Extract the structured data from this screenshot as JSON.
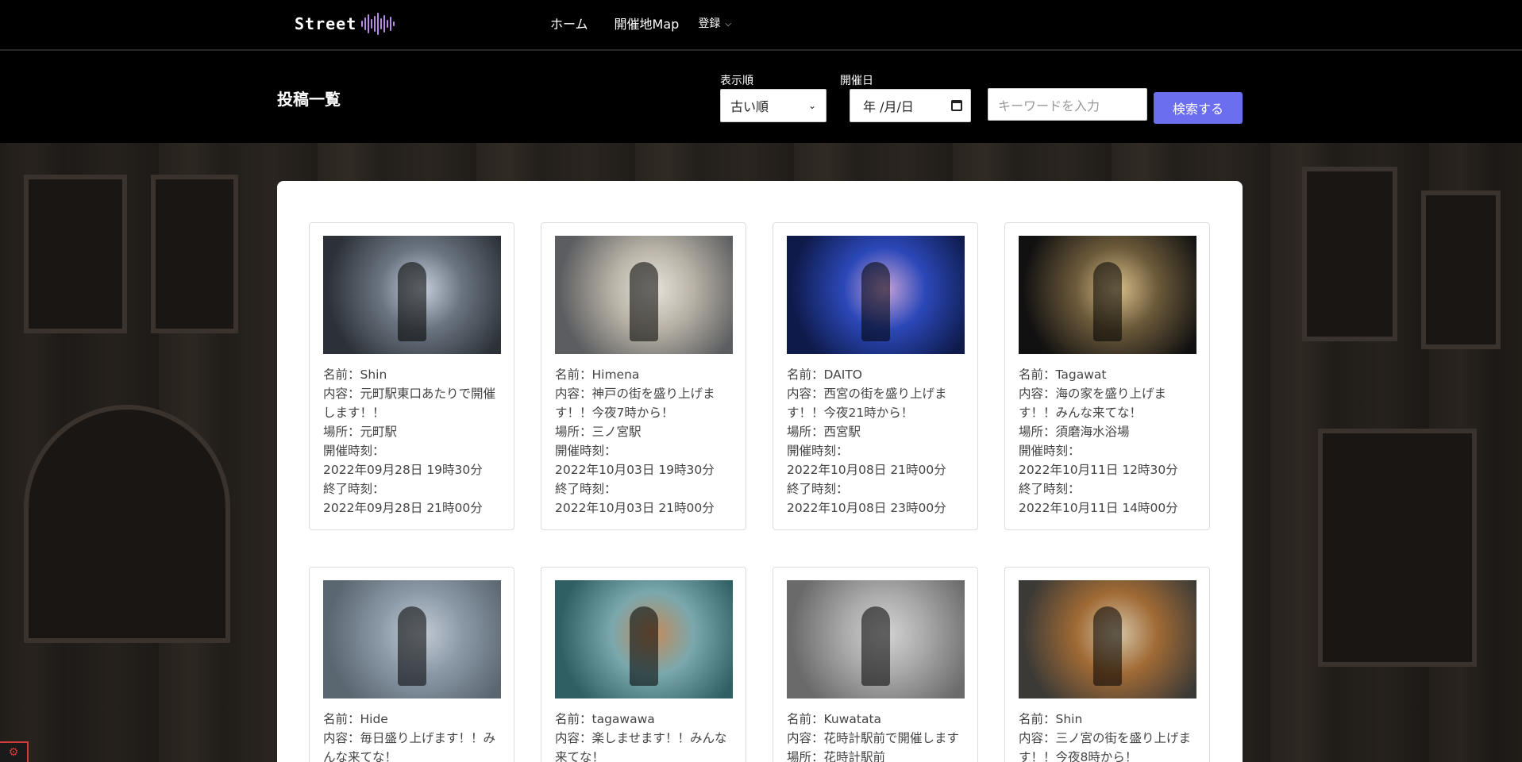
{
  "nav": {
    "brand": "Street",
    "links": [
      "ホーム",
      "開催地Map"
    ],
    "dropdown": "登録"
  },
  "search": {
    "title": "投稿一覧",
    "order_label": "表示順",
    "order_value": "古い順",
    "date_label": "開催日",
    "date_value": "年 /月/日",
    "keyword_placeholder": "キーワードを入力",
    "submit": "検索する"
  },
  "posts": [
    {
      "name": "名前：Shin",
      "content": "内容：元町駅東口あたりで開催します！！",
      "place": "場所：元町駅",
      "start_label": "開催時刻：",
      "start": "2022年09月28日 19時30分",
      "end_label": "終了時刻：",
      "end": "2022年09月28日 21時00分"
    },
    {
      "name": "名前：Himena",
      "content": "内容：神戸の街を盛り上げます！！今夜7時から！",
      "place": "場所：三ノ宮駅",
      "start_label": "開催時刻：",
      "start": "2022年10月03日 19時30分",
      "end_label": "終了時刻：",
      "end": "2022年10月03日 21時00分"
    },
    {
      "name": "名前：DAITO",
      "content": "内容：西宮の街を盛り上げます！！今夜21時から！",
      "place": "場所：西宮駅",
      "start_label": "開催時刻：",
      "start": "2022年10月08日 21時00分",
      "end_label": "終了時刻：",
      "end": "2022年10月08日 23時00分"
    },
    {
      "name": "名前：Tagawat",
      "content": "内容：海の家を盛り上げます！！みんな来てな！",
      "place": "場所：須磨海水浴場",
      "start_label": "開催時刻：",
      "start": "2022年10月11日 12時30分",
      "end_label": "終了時刻：",
      "end": "2022年10月11日 14時00分"
    },
    {
      "name": "名前：Hide",
      "content": "内容：毎日盛り上げます！！みんな来てな！",
      "place": "",
      "start_label": "",
      "start": "",
      "end_label": "",
      "end": ""
    },
    {
      "name": "名前：tagawawa",
      "content": "内容：楽しませます！！みんな来てな！",
      "place": "",
      "start_label": "",
      "start": "",
      "end_label": "",
      "end": ""
    },
    {
      "name": "名前：Kuwatata",
      "content": "内容：花時計駅前で開催します",
      "place": "場所：花時計駅前",
      "start_label": "",
      "start": "",
      "end_label": "",
      "end": ""
    },
    {
      "name": "名前：Shin",
      "content": "内容：三ノ宮の街を盛り上げます！！今夜8時から！",
      "place": "",
      "start_label": "",
      "start": "",
      "end_label": "",
      "end": ""
    }
  ],
  "thumb_colors": [
    [
      "#2c3138",
      "#6a7480",
      "#c9d2de"
    ],
    [
      "#5b5d60",
      "#b8b2a6",
      "#e8e4dc"
    ],
    [
      "#0e1a4a",
      "#2b48b8",
      "#c9a3d9"
    ],
    [
      "#111111",
      "#6c5a3a",
      "#d9c08a"
    ],
    [
      "#5a6670",
      "#8c9aa8",
      "#c4ccd4"
    ],
    [
      "#2f5e63",
      "#7aa8ad",
      "#c48a5a"
    ],
    [
      "#6a6a6a",
      "#a9a9a9",
      "#d4d4d4"
    ],
    [
      "#3c3a36",
      "#a06a35",
      "#d6c6a8"
    ]
  ]
}
